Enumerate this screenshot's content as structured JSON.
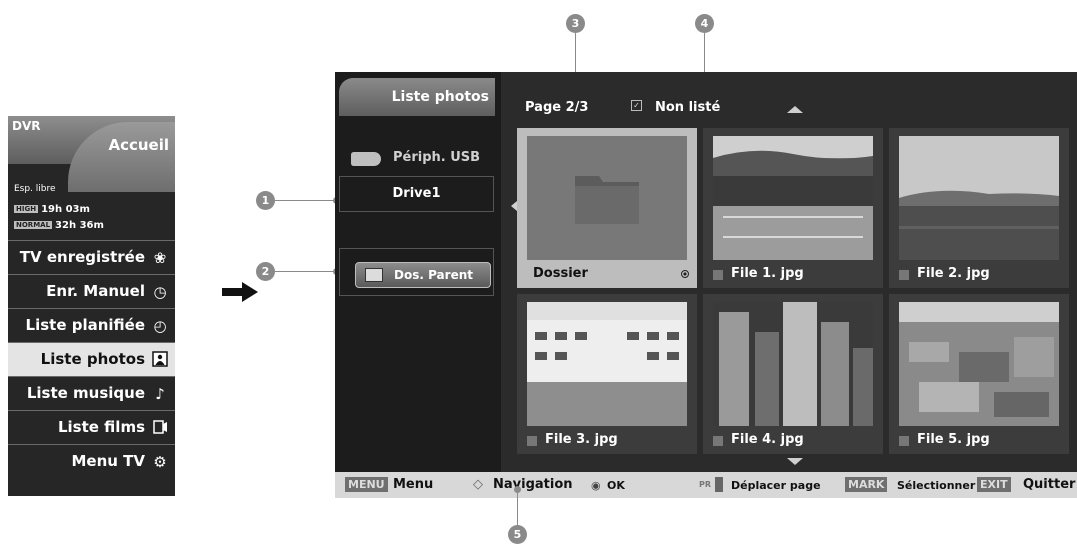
{
  "callouts": [
    "1",
    "2",
    "3",
    "4",
    "5"
  ],
  "dvr_menu": {
    "dvr_label": "DVR",
    "home_label": "Accueil",
    "free_space_label": "Esp. libre",
    "high_badge": "HIGH",
    "high_time": "19h 03m",
    "normal_badge": "NORMAL",
    "normal_time": "32h 36m",
    "items": [
      {
        "label": "TV enregistrée",
        "icon": "film-reel-icon"
      },
      {
        "label": "Enr. Manuel",
        "icon": "clock-record-icon"
      },
      {
        "label": "Liste planifiée",
        "icon": "schedule-clock-icon"
      },
      {
        "label": "Liste photos",
        "icon": "photo-icon",
        "selected": true
      },
      {
        "label": "Liste musique",
        "icon": "music-note-icon"
      },
      {
        "label": "Liste films",
        "icon": "movie-icon"
      },
      {
        "label": "Menu TV",
        "icon": "gears-icon"
      }
    ]
  },
  "screen": {
    "panel_title": "Liste photos",
    "device_label": "Périph. USB",
    "drive_label": "Drive1",
    "parent_button": "Dos. Parent",
    "page_indicator": "Page 2/3",
    "unlisted_label": "Non listé",
    "tiles": [
      {
        "name": "Dossier",
        "type": "folder",
        "selected": true
      },
      {
        "name": "File 1. jpg",
        "type": "photo-stadium"
      },
      {
        "name": "File 2. jpg",
        "type": "photo-coast"
      },
      {
        "name": "File 3. jpg",
        "type": "photo-building"
      },
      {
        "name": "File 4. jpg",
        "type": "photo-skyscrapers"
      },
      {
        "name": "File 5. jpg",
        "type": "photo-cityscape"
      }
    ],
    "bottom_bar": {
      "menu_key": "MENU",
      "menu_label": "Menu",
      "nav_label": "Navigation",
      "ok_label": "OK",
      "pr_label": "PR",
      "move_page_label": "Déplacer page",
      "mark_key": "MARK",
      "select_label": "Sélectionner",
      "exit_key": "EXIT",
      "quit_label": "Quitter"
    }
  },
  "colors": {
    "screen_bg": "#2b2b2b",
    "panel_bg": "#1c1c1c",
    "selected_tile": "#bdbdbd",
    "callout": "#8a8a8a"
  }
}
